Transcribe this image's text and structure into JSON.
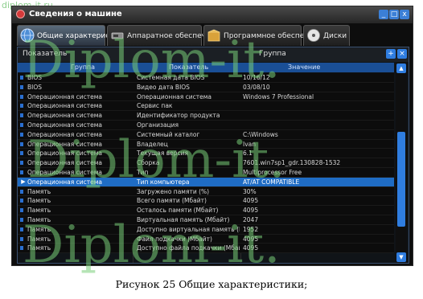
{
  "watermark_top": "diplom-it.ru",
  "window": {
    "title": "Сведения о машине",
    "controls": [
      "_",
      "□",
      "x"
    ]
  },
  "tabs": [
    {
      "label": "Общие характеристики",
      "icon": "info-globe-icon"
    },
    {
      "label": "Аппаратное обеспечение",
      "icon": "hardware-icon"
    },
    {
      "label": "Программное обеспечение",
      "icon": "software-box-icon"
    },
    {
      "label": "Диски",
      "icon": "disk-icon"
    }
  ],
  "panel": {
    "indicator_label": "Показатель",
    "group_label": "Группа",
    "columns": [
      "Группа",
      "Показатель",
      "Значение"
    ],
    "rows": [
      {
        "group": "BIOS",
        "indicator": "Системная дата BIOS",
        "value": "10/16/12"
      },
      {
        "group": "BIOS",
        "indicator": "Видео дата BIOS",
        "value": "03/08/10"
      },
      {
        "group": "Операционная система",
        "indicator": "Операционная система",
        "value": "Windows 7 Professional"
      },
      {
        "group": "Операционная система",
        "indicator": "Сервис пак",
        "value": ""
      },
      {
        "group": "Операционная система",
        "indicator": "Идентификатор продукта",
        "value": ""
      },
      {
        "group": "Операционная система",
        "indicator": "Организация",
        "value": ""
      },
      {
        "group": "Операционная система",
        "indicator": "Системный каталог",
        "value": "C:\\Windows"
      },
      {
        "group": "Операционная система",
        "indicator": "Владелец",
        "value": "Ivan"
      },
      {
        "group": "Операционная система",
        "indicator": "Текущая версия",
        "value": "6.1"
      },
      {
        "group": "Операционная система",
        "indicator": "Сборка",
        "value": "7601.win7sp1_gdr.130828-1532"
      },
      {
        "group": "Операционная система",
        "indicator": "Тип",
        "value": "Multiprocessor Free"
      },
      {
        "group": "Операционная система",
        "indicator": "Тип компьютера",
        "value": "AT/AT COMPATIBLE",
        "selected": true
      },
      {
        "group": "Память",
        "indicator": "Загружено памяти (%)",
        "value": "30%"
      },
      {
        "group": "Память",
        "indicator": "Всего памяти (Мбайт)",
        "value": "4095"
      },
      {
        "group": "Память",
        "indicator": "Осталось памяти (Мбайт)",
        "value": "4095"
      },
      {
        "group": "Память",
        "indicator": "Виртуальная память (Мбайт)",
        "value": "2047"
      },
      {
        "group": "Память",
        "indicator": "Доступно виртуальная память (Мба",
        "value": "1952"
      },
      {
        "group": "Память",
        "indicator": "Файл подкачки (Мбайт)",
        "value": "4095"
      },
      {
        "group": "Память",
        "indicator": "Доступно файла подкачки (Мбайт)",
        "value": "4095"
      }
    ],
    "scroll_up": "▲",
    "scroll_down": "▼"
  },
  "watermark": "Diplom-it.",
  "caption": "Рисунок 25 Общие характеристики;",
  "colors": {
    "selection": "#1f6cc4",
    "accent": "#2f7de0",
    "watermark": "#78cd78"
  }
}
